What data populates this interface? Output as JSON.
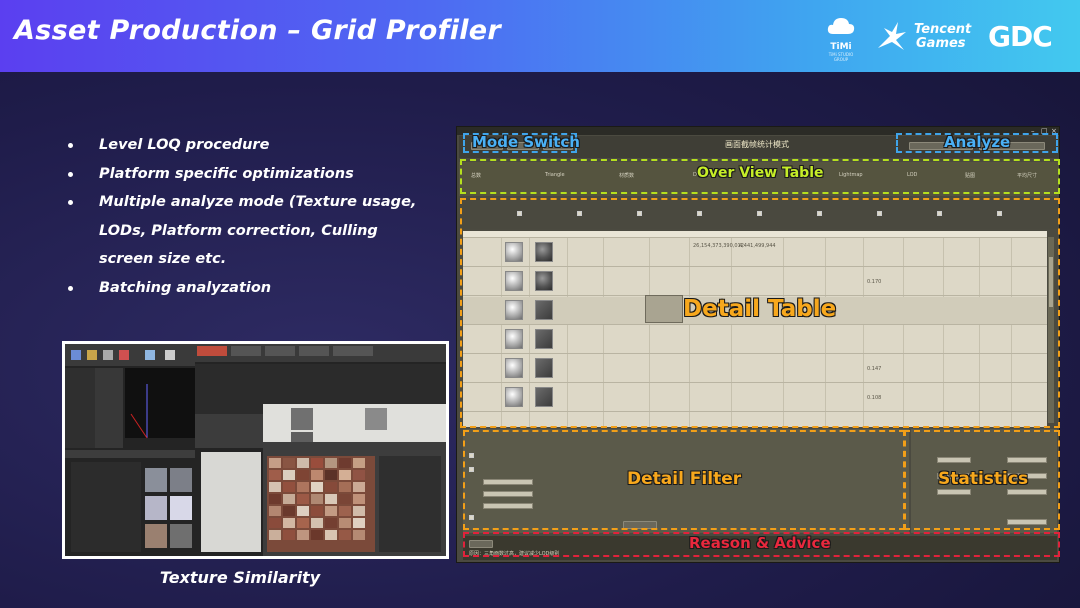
{
  "slide": {
    "title": "Asset Production – Grid Profiler",
    "caption": "Texture Similarity"
  },
  "logos": {
    "timi": {
      "name": "TiMi",
      "sub": "TiMi STUDIO GROUP"
    },
    "tencent": {
      "line1": "Tencent",
      "line2": "Games"
    },
    "gdc": "GDC"
  },
  "bullets": [
    "Level LOQ procedure",
    "Platform specific optimizations",
    "Multiple analyze mode (Texture usage, LODs, Platform correction, Culling screen size etc.",
    "Batching analyzation"
  ],
  "annotations": {
    "mode_switch": "Mode Switch",
    "analyze": "Analyze",
    "overview_table": "Over View Table",
    "detail_table": "Detail Table",
    "detail_filter": "Detail Filter",
    "statistics": "Statistics",
    "reason_advice": "Reason & Advice"
  },
  "tool": {
    "mode_heading": "画面截帧统计模式",
    "overview_cells": [
      "总数",
      "Triangle",
      "材质数",
      "DrawCall",
      "Lightmap",
      "LOD",
      "贴图",
      "平均尺寸"
    ],
    "table_values": [
      "26,154,373,390,012",
      "4,441,499,944",
      "0.170",
      "0.147",
      "0.108"
    ],
    "reason_text": "原因：三角面数过高，建议减少LOD级别"
  },
  "colors": {
    "blue": "#3fa4ea",
    "green": "#b5e01e",
    "orange": "#f29f18",
    "red": "#e1223b",
    "header_start": "#5b3ff0",
    "header_end": "#42c9ef"
  }
}
